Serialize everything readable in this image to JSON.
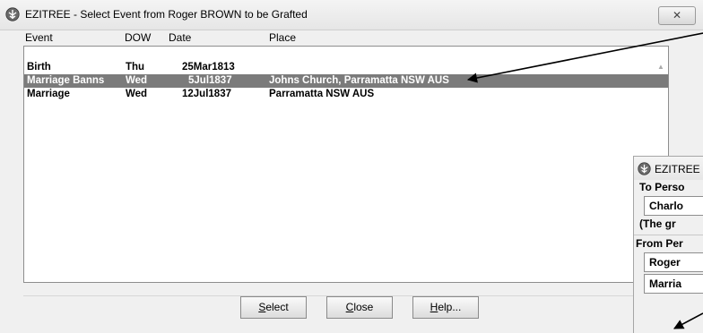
{
  "window": {
    "title": "EZITREE - Select Event from Roger BROWN to be Grafted",
    "close_label": "✕"
  },
  "columns": [
    "Event",
    "DOW",
    "Date",
    "Place"
  ],
  "rows": [
    {
      "event": "Birth",
      "dow": "Thu",
      "date": "25Mar1813",
      "place": "",
      "selected": false
    },
    {
      "event": "Marriage Banns",
      "dow": "Wed",
      "date": "5Jul1837",
      "place": "Johns Church, Parramatta NSW AUS",
      "selected": true
    },
    {
      "event": "Marriage",
      "dow": "Wed",
      "date": "12Jul1837",
      "place": "Parramatta NSW AUS",
      "selected": false
    }
  ],
  "buttons": {
    "select": {
      "mnemonic": "S",
      "rest": "elect"
    },
    "close": {
      "mnemonic": "C",
      "rest": "lose"
    },
    "help": {
      "mnemonic": "H",
      "rest": "elp..."
    }
  },
  "second_dialog": {
    "title": "EZITREE",
    "to_person_label": "To Perso",
    "to_name": "Charlo",
    "to_note": "(The gr",
    "from_person_label": "From Per",
    "from_name": "Roger",
    "from_event": "Marria"
  }
}
